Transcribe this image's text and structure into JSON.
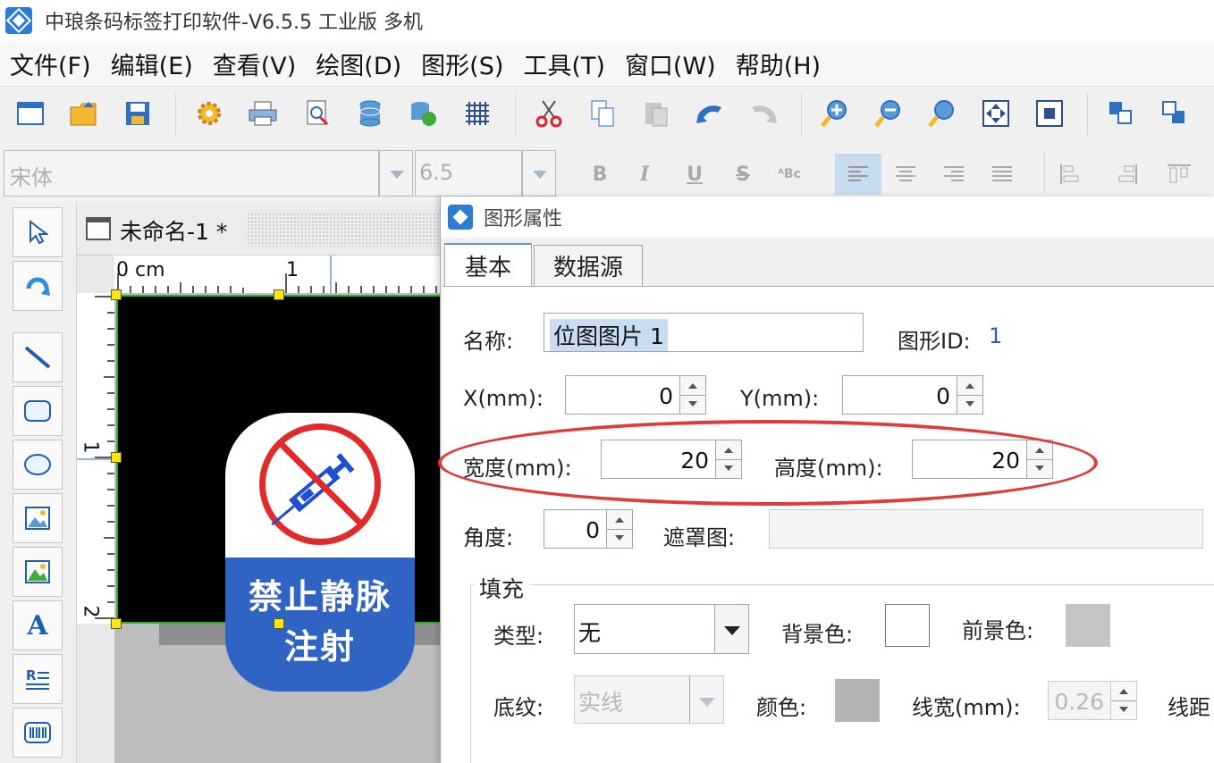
{
  "window": {
    "title": "中琅条码标签打印软件-V6.5.5 工业版 多机"
  },
  "menu": [
    {
      "label": "文件(F)"
    },
    {
      "label": "编辑(E)"
    },
    {
      "label": "查看(V)"
    },
    {
      "label": "绘图(D)"
    },
    {
      "label": "图形(S)"
    },
    {
      "label": "工具(T)"
    },
    {
      "label": "窗口(W)"
    },
    {
      "label": "帮助(H)"
    }
  ],
  "toolbar_icons": [
    "new-window-icon",
    "open-folder-icon",
    "save-icon",
    "settings-gear-icon",
    "print-icon",
    "print-preview-icon",
    "database-icon",
    "database-connect-icon",
    "grid-icon",
    "cut-icon",
    "copy-icon",
    "paste-icon",
    "undo-icon",
    "redo-icon",
    "zoom-in-icon",
    "zoom-out-icon",
    "zoom-icon",
    "fit-page-icon",
    "fit-selection-icon",
    "bring-front-icon",
    "send-back-icon"
  ],
  "format": {
    "font": "宋体",
    "size": "6.5",
    "bold": "B",
    "italic": "I",
    "underline": "U",
    "strike": "S",
    "special": "ᴬBᴄ"
  },
  "document": {
    "tab_title": "未命名-1 *",
    "ruler_top": [
      "0 cm",
      "1"
    ],
    "ruler_left": [
      "1",
      "2"
    ],
    "sign_text_line1": "禁止静脉",
    "sign_text_line2": "注射"
  },
  "dialog": {
    "title": "图形属性",
    "tabs": [
      {
        "label": "基本"
      },
      {
        "label": "数据源"
      }
    ],
    "name_label": "名称:",
    "name_value": "位图图片 1",
    "id_label": "图形ID:",
    "id_value": "1",
    "x_label": "X(mm):",
    "x_value": "0",
    "y_label": "Y(mm):",
    "y_value": "0",
    "width_label": "宽度(mm):",
    "width_value": "20",
    "height_label": "高度(mm):",
    "height_value": "20",
    "angle_label": "角度:",
    "angle_value": "0",
    "mask_label": "遮罩图:",
    "fill": {
      "group_title": "填充",
      "type_label": "类型:",
      "type_value": "无",
      "bg_label": "背景色:",
      "fg_label": "前景色:",
      "pattern_label": "底纹:",
      "pattern_value": "实线",
      "color_label": "颜色:",
      "linewidth_label": "线宽(mm):",
      "linewidth_value": "0.26",
      "spacing_label": "线距"
    }
  },
  "colors": {
    "accent": "#2d7cd3",
    "highlight": "#e23a3a",
    "sign_blue": "#2f64c4",
    "sign_red": "#e22a2a",
    "bg_color": "#ffffff",
    "fg_color": "#c4c4c4",
    "pattern_color": "#b4b4b4"
  }
}
